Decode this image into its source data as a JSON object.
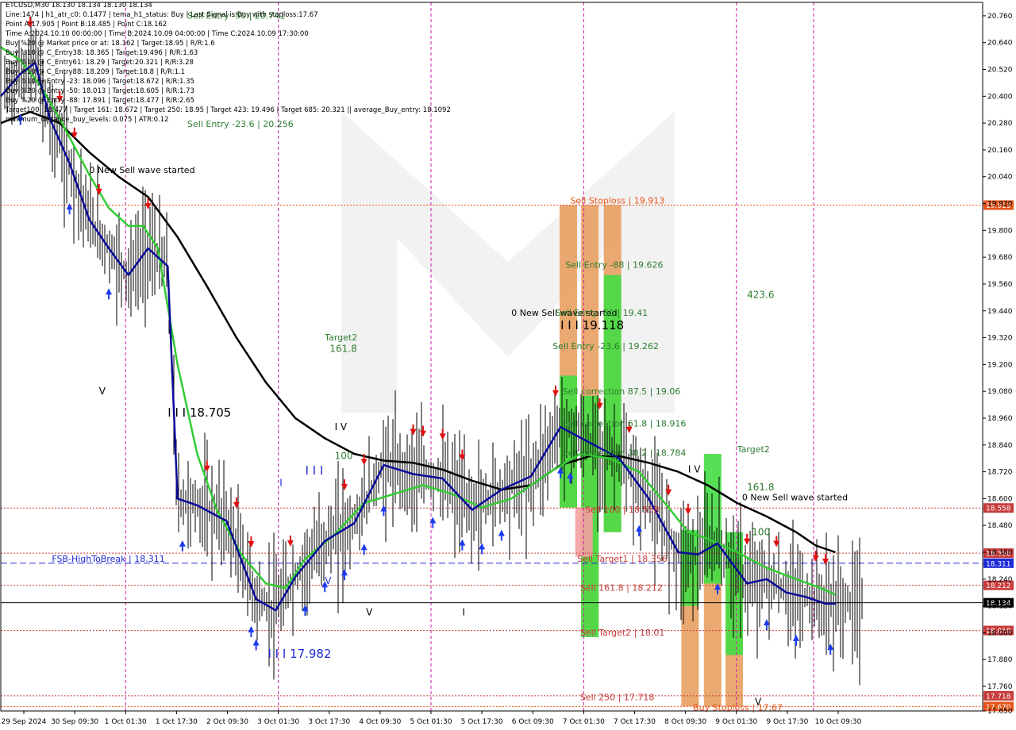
{
  "info_lines": [
    "ETCUSD,M30  18.130 18.134 18.130 18.134",
    "Line:1474 | h1_atr_c0: 0.1477 | tema_h1_status: Buy | Last Signal is:Buy with stoploss:17.67",
    "Point A:17.905 | Point B:18.485 | Point C:18.162",
    "Time A:2024.10.10 00:00:00 | Time B:2024.10.09 04:00:00 | Time C:2024.10.09 17:30:00",
    "Buy %20 @ Market price or at: 18.162 | Target:18.95 | R/R:1.6",
    "Buy %10 @ C_Entry38: 18.365 | Target:19.496 | R/R:1.63",
    "Buy %10 @ C_Entry61: 18.29 | Target:20.321 | R/R:3.28",
    "Buy %10 @ C_Entry88: 18.209 | Target:18.8 | R/R:1.1",
    "Buy %10 @ Entry -23: 18.096 | Target:18.672 | R/R:1.35",
    "Buy %20 @ Entry -50: 18.013 | Target:18.605 | R/R:1.73",
    "Buy %20 @ Entry -88: 17.891 | Target:18.477 | R/R:2.65",
    "Target100: 18.477 | Target 161: 18.672 | Target 250: 18.95 | Target 423: 19.496 | Target 685: 20.321 || average_Buy_entry: 18.1092",
    "minimum_distance_buy_levels: 0.075 | ATR:0.12"
  ],
  "chart_data": {
    "type": "candlestick",
    "symbol": "ETCUSD",
    "timeframe": "M30",
    "ylim": [
      17.65,
      20.82
    ],
    "yticks": [
      "20.760",
      "20.640",
      "20.520",
      "20.400",
      "20.280",
      "20.160",
      "20.040",
      "19.920",
      "19.800",
      "19.680",
      "19.560",
      "19.440",
      "19.320",
      "19.200",
      "19.080",
      "18.960",
      "18.840",
      "18.720",
      "18.600",
      "18.480",
      "18.360",
      "18.240",
      "18.120",
      "18.000",
      "17.880",
      "17.760",
      "17.650"
    ],
    "xticks": [
      "29 Sep 2024",
      "30 Sep 09:30",
      "1 Oct 01:30",
      "1 Oct 17:30",
      "2 Oct 09:30",
      "3 Oct 01:30",
      "3 Oct 17:30",
      "4 Oct 09:30",
      "5 Oct 01:30",
      "5 Oct 17:30",
      "6 Oct 09:30",
      "7 Oct 01:30",
      "7 Oct 17:30",
      "8 Oct 09:30",
      "9 Oct 01:30",
      "9 Oct 17:30",
      "10 Oct 09:30"
    ],
    "price_lines": [
      {
        "value": 19.913,
        "label": "19.913",
        "color": "#e8541a",
        "style": "dotted"
      },
      {
        "value": 18.558,
        "label": "18.558",
        "color": "#c83c3c",
        "style": "dotted"
      },
      {
        "value": 18.356,
        "label": "18.356",
        "color": "#c83c3c",
        "style": "dotted"
      },
      {
        "value": 18.311,
        "label": "18.311",
        "color": "#1e2bd6",
        "style": "dashed"
      },
      {
        "value": 18.212,
        "label": "18.212",
        "color": "#c83c3c",
        "style": "dotted"
      },
      {
        "value": 18.134,
        "label": "18.134",
        "color": "#000000",
        "style": "solid"
      },
      {
        "value": 18.01,
        "label": "18.010",
        "color": "#c83c3c",
        "style": "dotted"
      },
      {
        "value": 17.718,
        "label": "17.718",
        "color": "#c83c3c",
        "style": "dotted"
      },
      {
        "value": 17.67,
        "label": "17.670",
        "color": "#e8541a",
        "style": "dotted"
      }
    ],
    "annotations": [
      {
        "text": "Sell Entry -50 | 20.741",
        "x": 0.19,
        "y": 20.741,
        "color": "#2e7d32"
      },
      {
        "text": "Sell Entry -23.6 | 20.256",
        "x": 0.19,
        "y": 20.256,
        "color": "#2e7d32"
      },
      {
        "text": "0 New Sell wave started",
        "x": 0.09,
        "y": 20.05,
        "color": "#000000"
      },
      {
        "text": "Sell Stoploss | 19.913",
        "x": 0.58,
        "y": 19.913,
        "color": "#e8541a"
      },
      {
        "text": "Sell Entry -88 | 19.626",
        "x": 0.575,
        "y": 19.626,
        "color": "#2e7d32"
      },
      {
        "text": "423.6",
        "x": 0.76,
        "y": 19.49,
        "color": "#2e7d32"
      },
      {
        "text": "0 New Sell wave started",
        "x": 0.52,
        "y": 19.41,
        "color": "#000000"
      },
      {
        "text": "Sell Entry -50 | 19.41",
        "x": 0.565,
        "y": 19.41,
        "color": "#2e7d32"
      },
      {
        "text": "I I I 19.118",
        "x": 0.57,
        "y": 19.35,
        "color": "#000000"
      },
      {
        "text": "Target2",
        "x": 0.33,
        "y": 19.3,
        "color": "#2e7d32"
      },
      {
        "text": "161.8",
        "x": 0.335,
        "y": 19.25,
        "color": "#2e7d32"
      },
      {
        "text": "Sell Entry -23.6 | 19.262",
        "x": 0.562,
        "y": 19.262,
        "color": "#2e7d32"
      },
      {
        "text": "Sell correction 87.5 | 19.06",
        "x": 0.572,
        "y": 19.06,
        "color": "#2e7d32"
      },
      {
        "text": "V",
        "x": 0.1,
        "y": 19.06,
        "color": "#000000"
      },
      {
        "text": "I I I 18.705",
        "x": 0.17,
        "y": 18.96,
        "color": "#000000"
      },
      {
        "text": "Sell correction 61.8 | 18.916",
        "x": 0.572,
        "y": 18.916,
        "color": "#2e7d32"
      },
      {
        "text": "I V",
        "x": 0.34,
        "y": 18.9,
        "color": "#000000"
      },
      {
        "text": "Sell correction 38.2 | 18.784",
        "x": 0.572,
        "y": 18.784,
        "color": "#2e7d32"
      },
      {
        "text": "Target2",
        "x": 0.75,
        "y": 18.8,
        "color": "#2e7d32"
      },
      {
        "text": "100",
        "x": 0.34,
        "y": 18.77,
        "color": "#2e7d32"
      },
      {
        "text": "I V",
        "x": 0.7,
        "y": 18.71,
        "color": "#000000"
      },
      {
        "text": "I",
        "x": 0.284,
        "y": 18.65,
        "color": "#1e2bd6"
      },
      {
        "text": "I I I",
        "x": 0.31,
        "y": 18.7,
        "color": "#1e2bd6"
      },
      {
        "text": "161.8",
        "x": 0.76,
        "y": 18.63,
        "color": "#2e7d32"
      },
      {
        "text": "0 New Sell wave started",
        "x": 0.755,
        "y": 18.585,
        "color": "#000000"
      },
      {
        "text": "Sell 100 | 18.558",
        "x": 0.595,
        "y": 18.53,
        "color": "#c83c3c"
      },
      {
        "text": "100",
        "x": 0.765,
        "y": 18.43,
        "color": "#2e7d32"
      },
      {
        "text": "FSB-HighToBreak | 18.311",
        "x": 0.052,
        "y": 18.311,
        "color": "#1e2bd6"
      },
      {
        "text": "Sell Target1 | 18.356",
        "x": 0.587,
        "y": 18.31,
        "color": "#c83c3c"
      },
      {
        "text": "V",
        "x": 0.33,
        "y": 18.21,
        "color": "#1e2bd6"
      },
      {
        "text": "Sell 161.8 | 18.212",
        "x": 0.59,
        "y": 18.18,
        "color": "#c83c3c"
      },
      {
        "text": "V",
        "x": 0.372,
        "y": 18.07,
        "color": "#000000"
      },
      {
        "text": "I",
        "x": 0.47,
        "y": 18.07,
        "color": "#000000"
      },
      {
        "text": "Sell Target2 | 18.01",
        "x": 0.59,
        "y": 17.98,
        "color": "#c83c3c"
      },
      {
        "text": "I I I 17.982",
        "x": 0.272,
        "y": 17.88,
        "color": "#1e2bd6"
      },
      {
        "text": "Sell 250 | 17.718",
        "x": 0.59,
        "y": 17.69,
        "color": "#c83c3c"
      },
      {
        "text": "Buy Stoploss | 17.67",
        "x": 0.705,
        "y": 17.645,
        "color": "#e8541a"
      },
      {
        "text": "V",
        "x": 0.768,
        "y": 17.67,
        "color": "#000000"
      }
    ],
    "vertical_markers": [
      "1 Oct 01:30",
      "3 Oct 01:30",
      "5 Oct 01:30",
      "7 Oct 01:30",
      "9 Oct 01:30",
      "10 Oct 01:30"
    ],
    "ema_green": [
      [
        0,
        20.62
      ],
      [
        0.02,
        20.56
      ],
      [
        0.04,
        20.45
      ],
      [
        0.06,
        20.3
      ],
      [
        0.09,
        20.05
      ],
      [
        0.11,
        19.9
      ],
      [
        0.13,
        19.82
      ],
      [
        0.145,
        19.82
      ],
      [
        0.16,
        19.72
      ],
      [
        0.18,
        19.2
      ],
      [
        0.2,
        18.8
      ],
      [
        0.22,
        18.55
      ],
      [
        0.245,
        18.35
      ],
      [
        0.27,
        18.22
      ],
      [
        0.29,
        18.2
      ],
      [
        0.31,
        18.33
      ],
      [
        0.34,
        18.44
      ],
      [
        0.37,
        18.58
      ],
      [
        0.4,
        18.62
      ],
      [
        0.43,
        18.66
      ],
      [
        0.46,
        18.62
      ],
      [
        0.49,
        18.56
      ],
      [
        0.52,
        18.6
      ],
      [
        0.56,
        18.72
      ],
      [
        0.59,
        18.8
      ],
      [
        0.62,
        18.78
      ],
      [
        0.65,
        18.72
      ],
      [
        0.68,
        18.56
      ],
      [
        0.7,
        18.45
      ],
      [
        0.72,
        18.42
      ],
      [
        0.75,
        18.36
      ],
      [
        0.78,
        18.29
      ],
      [
        0.81,
        18.24
      ],
      [
        0.835,
        18.2
      ],
      [
        0.85,
        18.17
      ]
    ],
    "ema_black": [
      [
        0,
        20.28
      ],
      [
        0.03,
        20.33
      ],
      [
        0.06,
        20.28
      ],
      [
        0.09,
        20.15
      ],
      [
        0.12,
        20.04
      ],
      [
        0.15,
        19.95
      ],
      [
        0.18,
        19.77
      ],
      [
        0.21,
        19.55
      ],
      [
        0.24,
        19.32
      ],
      [
        0.27,
        19.12
      ],
      [
        0.3,
        18.96
      ],
      [
        0.33,
        18.87
      ],
      [
        0.36,
        18.8
      ],
      [
        0.39,
        18.77
      ],
      [
        0.42,
        18.76
      ],
      [
        0.45,
        18.73
      ],
      [
        0.48,
        18.68
      ],
      [
        0.51,
        18.64
      ],
      [
        0.54,
        18.66
      ],
      [
        0.57,
        18.75
      ],
      [
        0.6,
        18.79
      ],
      [
        0.63,
        18.79
      ],
      [
        0.66,
        18.76
      ],
      [
        0.69,
        18.72
      ],
      [
        0.72,
        18.66
      ],
      [
        0.75,
        18.58
      ],
      [
        0.78,
        18.52
      ],
      [
        0.81,
        18.45
      ],
      [
        0.83,
        18.39
      ],
      [
        0.85,
        18.36
      ]
    ],
    "ema_blue": [
      [
        0,
        20.4
      ],
      [
        0.02,
        20.5
      ],
      [
        0.035,
        20.55
      ],
      [
        0.05,
        20.3
      ],
      [
        0.07,
        20.1
      ],
      [
        0.09,
        19.85
      ],
      [
        0.11,
        19.72
      ],
      [
        0.13,
        19.6
      ],
      [
        0.15,
        19.72
      ],
      [
        0.17,
        19.64
      ],
      [
        0.18,
        18.6
      ],
      [
        0.2,
        18.57
      ],
      [
        0.23,
        18.5
      ],
      [
        0.26,
        18.15
      ],
      [
        0.28,
        18.1
      ],
      [
        0.3,
        18.25
      ],
      [
        0.33,
        18.41
      ],
      [
        0.36,
        18.49
      ],
      [
        0.39,
        18.75
      ],
      [
        0.42,
        18.71
      ],
      [
        0.45,
        18.69
      ],
      [
        0.48,
        18.55
      ],
      [
        0.51,
        18.64
      ],
      [
        0.54,
        18.7
      ],
      [
        0.57,
        18.92
      ],
      [
        0.6,
        18.85
      ],
      [
        0.63,
        18.78
      ],
      [
        0.66,
        18.6
      ],
      [
        0.69,
        18.36
      ],
      [
        0.71,
        18.35
      ],
      [
        0.73,
        18.4
      ],
      [
        0.76,
        18.22
      ],
      [
        0.78,
        18.24
      ],
      [
        0.8,
        18.18
      ],
      [
        0.82,
        18.16
      ],
      [
        0.84,
        18.13
      ],
      [
        0.85,
        18.13
      ]
    ],
    "zone_bars": [
      {
        "x": 0.578,
        "y_top": 19.913,
        "y_bottom": 18.56,
        "color": "#e8a060"
      },
      {
        "x": 0.6,
        "y_top": 19.913,
        "y_bottom": 18.0,
        "color": "#e8a060"
      },
      {
        "x": 0.623,
        "y_top": 19.913,
        "y_bottom": 18.45,
        "color": "#e8a060"
      },
      {
        "x": 0.578,
        "y_top": 19.15,
        "y_bottom": 18.56,
        "color": "#44dd44"
      },
      {
        "x": 0.6,
        "y_top": 19.06,
        "y_bottom": 17.98,
        "color": "#44dd44"
      },
      {
        "x": 0.623,
        "y_top": 19.6,
        "y_bottom": 18.45,
        "color": "#44dd44"
      },
      {
        "x": 0.702,
        "y_top": 18.36,
        "y_bottom": 17.67,
        "color": "#e8a060"
      },
      {
        "x": 0.725,
        "y_top": 18.4,
        "y_bottom": 17.67,
        "color": "#e8a060"
      },
      {
        "x": 0.747,
        "y_top": 18.32,
        "y_bottom": 17.67,
        "color": "#e8a060"
      },
      {
        "x": 0.702,
        "y_top": 18.46,
        "y_bottom": 18.12,
        "color": "#44dd44"
      },
      {
        "x": 0.725,
        "y_top": 18.8,
        "y_bottom": 18.22,
        "color": "#44dd44"
      },
      {
        "x": 0.747,
        "y_top": 18.45,
        "y_bottom": 17.9,
        "color": "#44dd44"
      },
      {
        "x": 0.594,
        "y_top": 18.56,
        "y_bottom": 18.34,
        "color": "#f4a0a0"
      }
    ]
  }
}
